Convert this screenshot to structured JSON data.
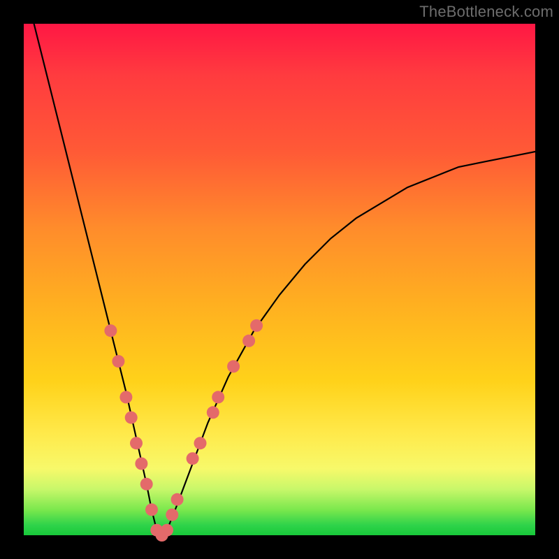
{
  "watermark": "TheBottleneck.com",
  "chart_data": {
    "type": "line",
    "title": "",
    "xlabel": "",
    "ylabel": "",
    "xlim": [
      0,
      100
    ],
    "ylim": [
      0,
      100
    ],
    "grid": false,
    "legend": false,
    "series": [
      {
        "name": "bottleneck-curve",
        "x": [
          2,
          5,
          8,
          11,
          14,
          17,
          20,
          22,
          24,
          25,
          26,
          27,
          28,
          30,
          33,
          36,
          40,
          45,
          50,
          55,
          60,
          65,
          70,
          75,
          80,
          85,
          90,
          95,
          100
        ],
        "y": [
          100,
          88,
          76,
          64,
          52,
          40,
          28,
          19,
          10,
          5,
          1,
          0,
          1,
          6,
          14,
          22,
          31,
          40,
          47,
          53,
          58,
          62,
          65,
          68,
          70,
          72,
          73,
          74,
          75
        ]
      }
    ],
    "markers": [
      {
        "x": 17,
        "y": 40
      },
      {
        "x": 18.5,
        "y": 34
      },
      {
        "x": 20,
        "y": 27
      },
      {
        "x": 21,
        "y": 23
      },
      {
        "x": 22,
        "y": 18
      },
      {
        "x": 23,
        "y": 14
      },
      {
        "x": 24,
        "y": 10
      },
      {
        "x": 25,
        "y": 5
      },
      {
        "x": 26,
        "y": 1
      },
      {
        "x": 27,
        "y": 0
      },
      {
        "x": 28,
        "y": 1
      },
      {
        "x": 29,
        "y": 4
      },
      {
        "x": 30,
        "y": 7
      },
      {
        "x": 33,
        "y": 15
      },
      {
        "x": 34.5,
        "y": 18
      },
      {
        "x": 37,
        "y": 24
      },
      {
        "x": 38,
        "y": 27
      },
      {
        "x": 41,
        "y": 33
      },
      {
        "x": 44,
        "y": 38
      },
      {
        "x": 45.5,
        "y": 41
      }
    ],
    "marker_color": "#e46a6a"
  }
}
